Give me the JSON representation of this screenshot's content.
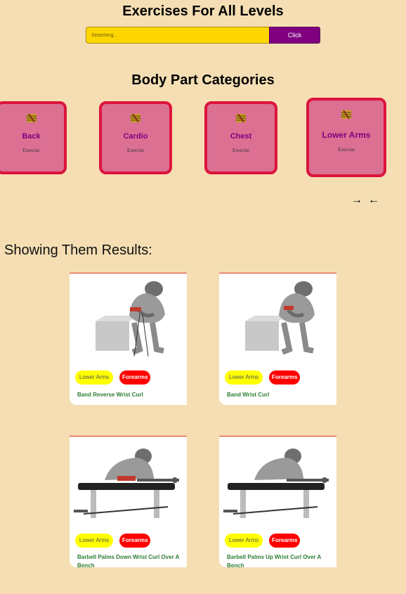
{
  "header": {
    "title": "Exercises For All Levels"
  },
  "search": {
    "placeholder": "Searching...",
    "button_label": "Click"
  },
  "categories_section": {
    "title": "Body Part Categories",
    "items": [
      {
        "name": "Back",
        "label": "Exercise"
      },
      {
        "name": "Cardio",
        "label": "Exercise"
      },
      {
        "name": "Chest",
        "label": "Exercise"
      },
      {
        "name": "Lower Arms",
        "label": "Exercise"
      }
    ],
    "arrows": {
      "next": "→",
      "prev": "←"
    }
  },
  "results": {
    "heading": "Showing Them Results:",
    "cards": [
      {
        "body_part": "Lower Arms",
        "target": "Forearms",
        "title": "Band Reverse Wrist Curl"
      },
      {
        "body_part": "Lower Arms",
        "target": "Forearms",
        "title": "Band Wrist Curl"
      },
      {
        "body_part": "Lower Arms",
        "target": "Forearms",
        "title": "Barbell Palms Down Wrist Curl Over A Bench"
      },
      {
        "body_part": "Lower Arms",
        "target": "Forearms",
        "title": "Barbell Palms Up Wrist Curl Over A Bench"
      }
    ]
  },
  "colors": {
    "background": "#f5deb3",
    "category_fill": "#db7093",
    "category_border": "#dc143c",
    "category_text": "#800080",
    "search_input": "#ffd700",
    "search_button": "#800080",
    "tag_bodypart": "#ffff00",
    "tag_target": "#ff0000",
    "card_title": "#2e7d32"
  },
  "icons": {
    "category_icon": "gym-icon"
  }
}
